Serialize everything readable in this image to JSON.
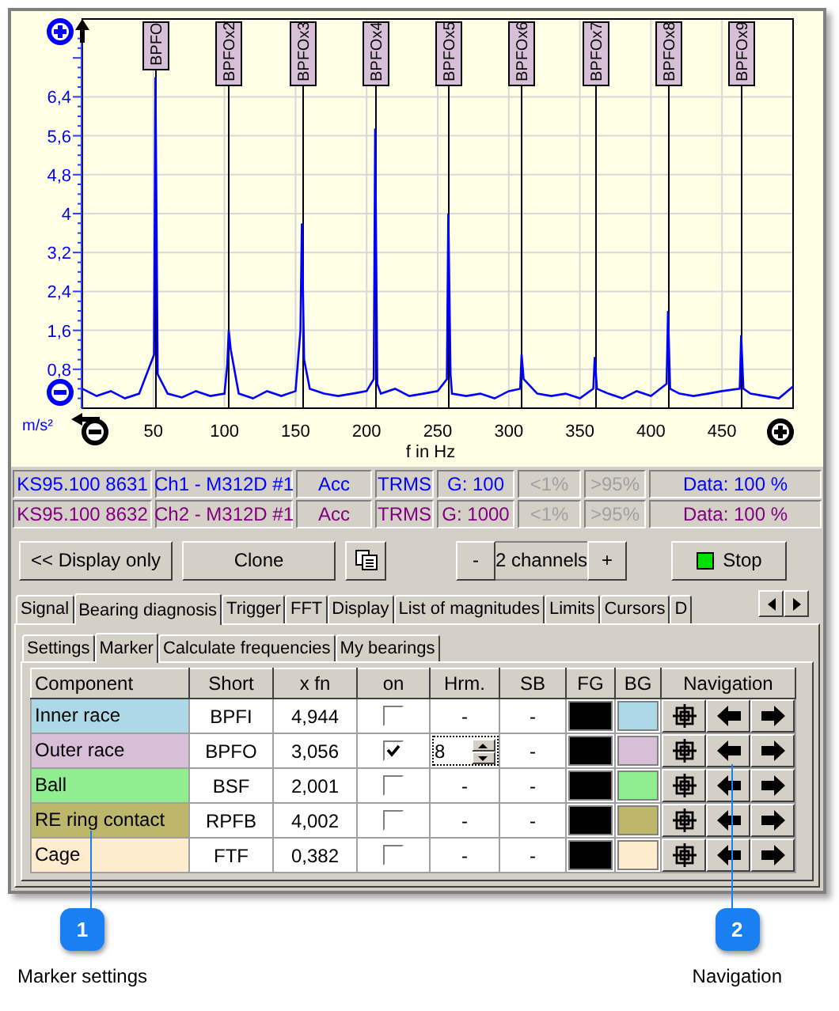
{
  "chart": {
    "chart_data": {
      "type": "line",
      "xlabel": "f in Hz",
      "ylabel": "m/s²",
      "xlim": [
        0,
        500
      ],
      "ylim": [
        0,
        8
      ],
      "grid": true,
      "xticks": [
        50,
        100,
        150,
        200,
        250,
        300,
        350,
        400,
        450
      ],
      "yticks": [
        {
          "value": 0.8,
          "label": "0,8"
        },
        {
          "value": 1.6,
          "label": "1,6"
        },
        {
          "value": 2.4,
          "label": "2,4"
        },
        {
          "value": 3.2,
          "label": "3,2"
        },
        {
          "value": 4,
          "label": "4"
        },
        {
          "value": 4.8,
          "label": "4,8"
        },
        {
          "value": 5.6,
          "label": "5,6"
        },
        {
          "value": 6.4,
          "label": "6,4"
        }
      ],
      "x": [
        0,
        10,
        20,
        30,
        40,
        50.5,
        51.5,
        53,
        60,
        70,
        80,
        90,
        100,
        102,
        103,
        104.5,
        110,
        120,
        130,
        140,
        150,
        153.5,
        154.5,
        156,
        160,
        170,
        180,
        190,
        200,
        205,
        206,
        207.5,
        210,
        220,
        230,
        240,
        250,
        256.5,
        257.5,
        259,
        260,
        270,
        280,
        290,
        300,
        308,
        309,
        310.5,
        320,
        330,
        340,
        350,
        359.5,
        360.5,
        362,
        370,
        380,
        390,
        400,
        411,
        412,
        413.5,
        420,
        430,
        440,
        450,
        462.5,
        463.5,
        465,
        470,
        480,
        490,
        500
      ],
      "series": [
        {
          "color": "#0000ff",
          "values": [
            0.4,
            0.25,
            0.35,
            0.2,
            0.3,
            1.1,
            6.8,
            0.7,
            0.3,
            0.22,
            0.35,
            0.25,
            0.3,
            0.9,
            1.6,
            1.2,
            0.3,
            0.2,
            0.35,
            0.25,
            0.35,
            1.6,
            3.8,
            1.0,
            0.4,
            0.3,
            0.25,
            0.3,
            0.35,
            0.6,
            5.75,
            0.5,
            0.3,
            0.4,
            0.25,
            0.3,
            0.35,
            0.6,
            4.0,
            0.7,
            0.3,
            0.25,
            0.3,
            0.2,
            0.35,
            0.4,
            1.1,
            0.6,
            0.3,
            0.25,
            0.3,
            0.2,
            0.4,
            1.05,
            0.4,
            0.3,
            0.2,
            0.35,
            0.25,
            0.5,
            2.0,
            0.4,
            0.3,
            0.25,
            0.3,
            0.35,
            0.4,
            1.5,
            0.4,
            0.3,
            0.25,
            0.2,
            0.45
          ]
        }
      ],
      "annotations": [
        {
          "x": 51.5,
          "text": "BPFO"
        },
        {
          "x": 103,
          "text": "BPFOx2"
        },
        {
          "x": 154.5,
          "text": "BPFOx3"
        },
        {
          "x": 206,
          "text": "BPFOx4"
        },
        {
          "x": 257.5,
          "text": "BPFOx5"
        },
        {
          "x": 309,
          "text": "BPFOx6"
        },
        {
          "x": 360.5,
          "text": "BPFOx7"
        },
        {
          "x": 412,
          "text": "BPFOx8"
        },
        {
          "x": 463.5,
          "text": "BPFOx9"
        }
      ]
    }
  },
  "channels": [
    {
      "device": "KS95.100 8631",
      "channel": "Ch1 - M312D #1",
      "quantity": "Acc",
      "mode": "TRMS",
      "gain": "G: 100",
      "low": "<1%",
      "high": ">95%",
      "data": "Data: 100 %",
      "color": "#0000ff"
    },
    {
      "device": "KS95.100 8632",
      "channel": "Ch2 - M312D #1",
      "quantity": "Acc",
      "mode": "TRMS",
      "gain": "G: 1000",
      "low": "<1%",
      "high": ">95%",
      "data": "Data: 100 %",
      "color": "#800080"
    }
  ],
  "toolbar": {
    "display_only": "<< Display only",
    "clone": "Clone",
    "minus": "-",
    "channels": "2 channels",
    "plus": "+",
    "stop": "Stop"
  },
  "tabs": [
    {
      "label": "Signal",
      "selected": false
    },
    {
      "label": "Bearing diagnosis",
      "selected": true
    },
    {
      "label": "Trigger",
      "selected": false
    },
    {
      "label": "FFT",
      "selected": false
    },
    {
      "label": "Display",
      "selected": false
    },
    {
      "label": "List of magnitudes",
      "selected": false
    },
    {
      "label": "Limits",
      "selected": false
    },
    {
      "label": "Cursors",
      "selected": false
    },
    {
      "label": "D",
      "selected": false
    }
  ],
  "subtabs": [
    {
      "label": "Settings",
      "selected": false
    },
    {
      "label": "Marker",
      "selected": true
    },
    {
      "label": "Calculate frequencies",
      "selected": false
    },
    {
      "label": "My bearings",
      "selected": false
    }
  ],
  "table": {
    "columns": [
      "Component",
      "Short",
      "x fn",
      "on",
      "Hrm.",
      "SB",
      "FG",
      "BG",
      "Navigation"
    ],
    "rows": [
      {
        "component": "Inner race",
        "short": "BPFI",
        "xfn": "4,944",
        "on": false,
        "hrm": {
          "kind": "text",
          "value": "-"
        },
        "sb": "-",
        "color": "#add8e6"
      },
      {
        "component": "Outer race",
        "short": "BPFO",
        "xfn": "3,056",
        "on": true,
        "hrm": {
          "kind": "spinner",
          "value": "8"
        },
        "sb": "-",
        "color": "#d8bfd8"
      },
      {
        "component": "Ball",
        "short": "BSF",
        "xfn": "2,001",
        "on": false,
        "hrm": {
          "kind": "text",
          "value": "-"
        },
        "sb": "-",
        "color": "#90ee90"
      },
      {
        "component": "RE ring contact",
        "short": "RPFB",
        "xfn": "4,002",
        "on": false,
        "hrm": {
          "kind": "text",
          "value": "-"
        },
        "sb": "-",
        "color": "#bdb76b"
      },
      {
        "component": "Cage",
        "short": "FTF",
        "xfn": "0,382",
        "on": false,
        "hrm": {
          "kind": "text",
          "value": "-"
        },
        "sb": "-",
        "color": "#ffebcd"
      }
    ]
  },
  "callouts": [
    {
      "number": "1",
      "label": "Marker settings"
    },
    {
      "number": "2",
      "label": "Navigation"
    }
  ]
}
